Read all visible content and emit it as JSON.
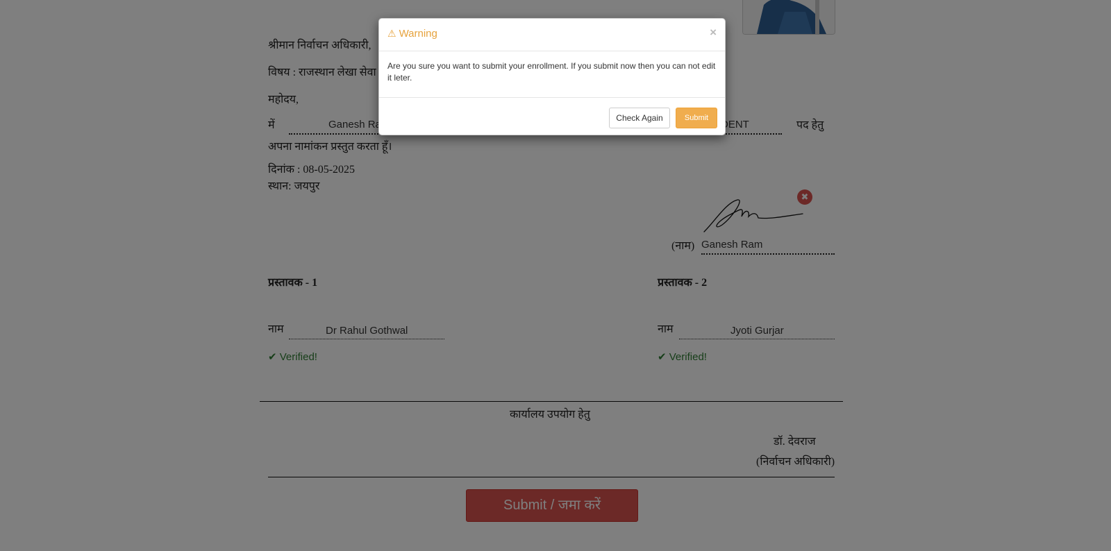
{
  "letter": {
    "salutation": "श्रीमान निर्वाचन अधिकारी,",
    "subject": "विषय : राजस्थान लेखा सेवा",
    "greeting": "महोदय,",
    "main_prefix": "में",
    "candidate_name": "Ganesh Ram",
    "post_value_visible": "DENT",
    "post_suffix": "पद हेतु",
    "statement": "अपना नामांकन प्रस्तुत करता हूँ।",
    "date_line": "दिनांक : 08-05-2025",
    "place_line": "स्थान: जयपुर"
  },
  "signature": {
    "name_label": "(नाम)",
    "name_value": "Ganesh Ram",
    "remove_icon": "remove-circle-icon"
  },
  "proposers": [
    {
      "heading": "प्रस्तावक - 1",
      "name_label": "नाम",
      "name_value": "Dr Rahul Gothwal",
      "status": "Verified!"
    },
    {
      "heading": "प्रस्तावक - 2",
      "name_label": "नाम",
      "name_value": "Jyoti Gurjar",
      "status": "Verified!"
    }
  ],
  "office_use": {
    "heading": "कार्यालय उपयोग हेतु",
    "officer_name": "डॉ. देवराज",
    "officer_title": "(निर्वाचन अधिकारी)"
  },
  "main_submit_label": "Submit / जमा करें",
  "modal": {
    "title": "Warning",
    "title_icon": "warning-triangle-icon",
    "close_glyph": "×",
    "body": "Are you sure you want to submit your enrollment. If you submit now then you can not edit it leter.",
    "check_again_label": "Check Again",
    "submit_label": "Submit"
  },
  "colors": {
    "overlay": "rgba(0,0,0,0.5)",
    "warning": "#f0ad4e",
    "danger": "#d9534f",
    "verified": "#2e7d32"
  }
}
